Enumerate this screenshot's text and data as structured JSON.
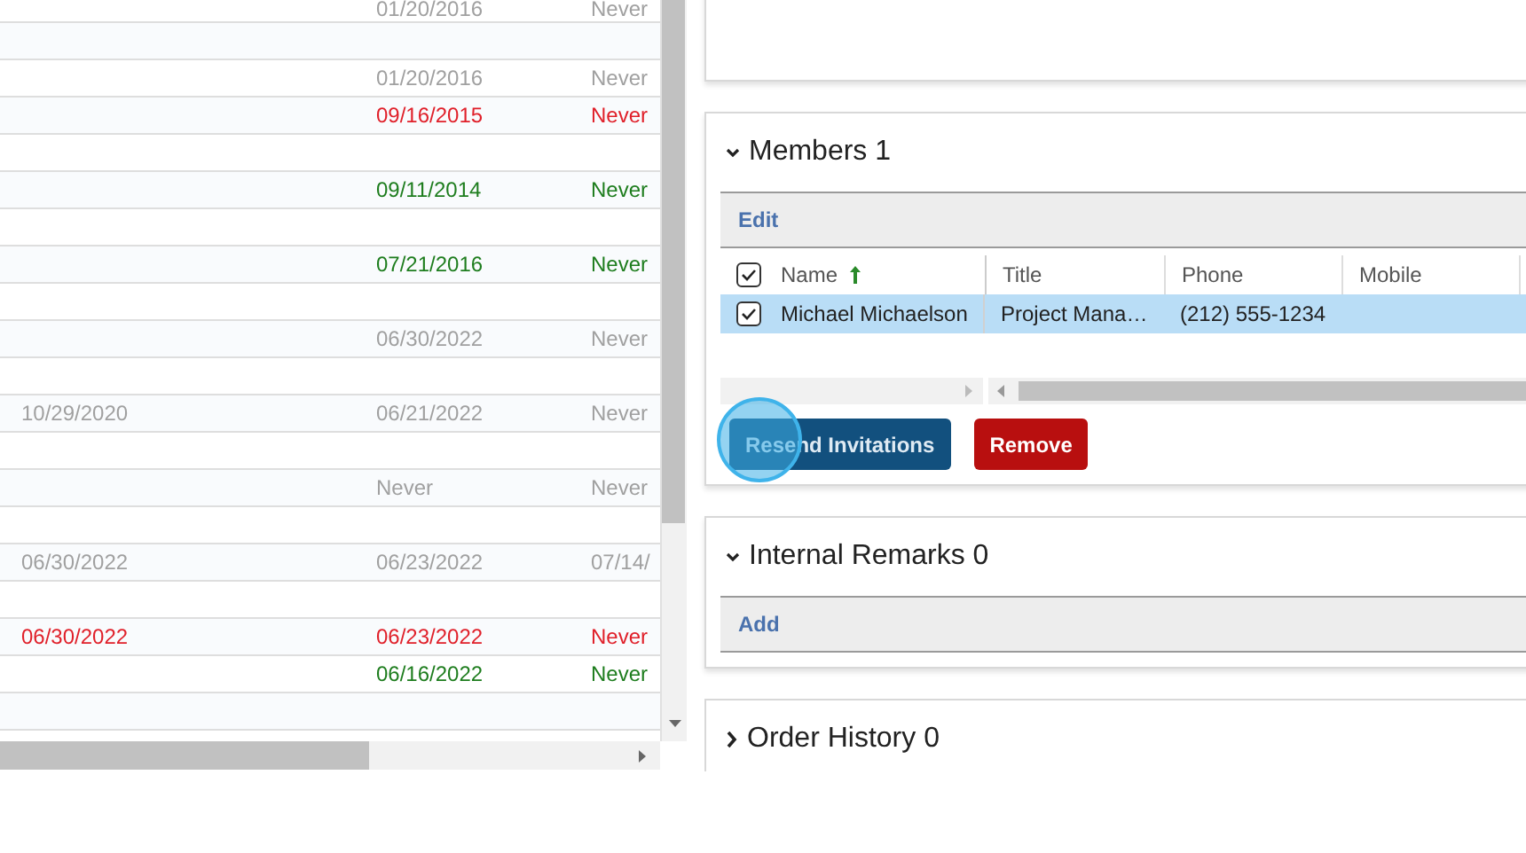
{
  "left_grid": {
    "rows": [
      {
        "color": "#a0a0a0",
        "column_2": "01/20/2016",
        "column_3": "Never"
      },
      {},
      {
        "color": "#a0a0a0",
        "column_2": "01/20/2016",
        "column_3": "Never"
      },
      {
        "color": "#e0202a",
        "column_2": "09/16/2015",
        "column_3": "Never"
      },
      {},
      {
        "color": "#1e7d1e",
        "column_2": "09/11/2014",
        "column_3": "Never"
      },
      {},
      {
        "color": "#1e7d1e",
        "column_2": "07/21/2016",
        "column_3": "Never"
      },
      {},
      {
        "color": "#a0a0a0",
        "column_2": "06/30/2022",
        "column_3": "Never"
      },
      {},
      {
        "color": "#a0a0a0",
        "column_1": "10/29/2020",
        "column_2": "06/21/2022",
        "column_3": "Never"
      },
      {},
      {
        "color": "#a0a0a0",
        "column_2": "Never",
        "column_3": "Never"
      },
      {},
      {
        "color": "#a0a0a0",
        "column_1": "06/30/2022",
        "column_2": "06/23/2022",
        "column_3": "07/14/"
      },
      {},
      {
        "color": "#e0202a",
        "column_1": "06/30/2022",
        "column_2": "06/23/2022",
        "column_3": "Never"
      },
      {
        "color": "#1e7d1e",
        "column_2": "06/16/2022",
        "column_3": "Never"
      },
      {}
    ]
  },
  "sections": [
    {
      "title": "Members 1",
      "expanded": true,
      "toolbar": [
        "Edit"
      ],
      "grid": {
        "all_checked": true,
        "columns": [
          {
            "label": "Name",
            "sorted": true
          },
          {
            "label": "Title"
          },
          {
            "label": "Phone"
          },
          {
            "label": "Mobile"
          }
        ],
        "rows": [
          {
            "checked": true,
            "selected": true,
            "cells": [
              "Michael Michaelson",
              "Project Mana…",
              "(212) 555-1234"
            ]
          }
        ]
      },
      "buttons": [
        {
          "label": "Resend Invitations",
          "kind": "primary"
        },
        {
          "label": "Remove",
          "kind": "danger"
        }
      ]
    },
    {
      "title": "Internal Remarks 0",
      "expanded": true,
      "toolbar": [
        "Add"
      ]
    },
    {
      "title": "Order History 0",
      "expanded": false
    }
  ]
}
